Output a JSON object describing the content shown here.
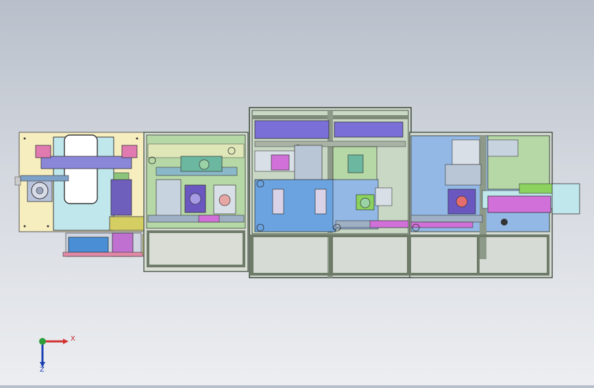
{
  "viewport": {
    "background_top": "#b8bfca",
    "background_bottom": "#eceef1"
  },
  "colors": {
    "frame": "#5a6a55",
    "feeder_plate": "#f7eec0",
    "panel_green": "#b6d8a6",
    "panel_blue": "#93b8e6",
    "panel_cyan": "#bfe7ec",
    "panel_purple": "#7a6fd6",
    "panel_magenta": "#d070d8",
    "panel_yellow": "#d8d47a",
    "panel_olive": "#c5c96d"
  },
  "triad": {
    "x_label": "X",
    "z_label": "Z",
    "x_color": "#d32f2f",
    "y_color": "#2e9e3a",
    "z_color": "#1a3fb3"
  }
}
